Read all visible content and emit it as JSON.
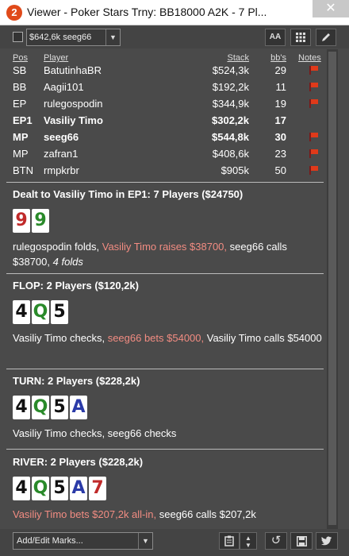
{
  "window": {
    "app_icon_text": "2",
    "title": "Viewer - Poker Stars Trny: BB18000 A2K - 7 Pl...",
    "close_glyph": "✕"
  },
  "toolbar": {
    "select_value": "$642,6k seeg66",
    "font_button_label": "AA"
  },
  "players": {
    "headers": {
      "pos": "Pos",
      "player": "Player",
      "stack": "Stack",
      "bbs": "bb's",
      "notes": "Notes"
    },
    "rows": [
      {
        "pos": "SB",
        "player": "BatutinhaBR",
        "stack": "$524,3k",
        "bbs": "29",
        "note": true,
        "bold": false
      },
      {
        "pos": "BB",
        "player": "Aagii101",
        "stack": "$192,2k",
        "bbs": "11",
        "note": true,
        "bold": false
      },
      {
        "pos": "EP",
        "player": "rulegospodin",
        "stack": "$344,9k",
        "bbs": "19",
        "note": true,
        "bold": false
      },
      {
        "pos": "EP1",
        "player": "Vasiliy Timo",
        "stack": "$302,2k",
        "bbs": "17",
        "note": false,
        "bold": true
      },
      {
        "pos": "MP",
        "player": "seeg66",
        "stack": "$544,8k",
        "bbs": "30",
        "note": true,
        "bold": true
      },
      {
        "pos": "MP",
        "player": "zafran1",
        "stack": "$408,6k",
        "bbs": "23",
        "note": true,
        "bold": false
      },
      {
        "pos": "BTN",
        "player": "rmpkrbr",
        "stack": "$905k",
        "bbs": "50",
        "note": true,
        "bold": false
      }
    ]
  },
  "preflop": {
    "title": "Dealt to Vasiliy Timo in EP1: 7 Players ($24750)",
    "cards": [
      "9",
      "9"
    ],
    "action_1": "rulegospodin folds, ",
    "action_hl": "Vasiliy Timo raises $38700,",
    "action_2": " seeg66 calls $38700, ",
    "action_it": "4 folds"
  },
  "flop": {
    "title": "FLOP: 2 Players ($120,2k)",
    "cards": [
      "4",
      "Q",
      "5"
    ],
    "action_1": "Vasiliy Timo checks, ",
    "action_hl": "seeg66 bets $54000,",
    "action_2": " Vasiliy Timo calls $54000"
  },
  "turn": {
    "title": "TURN: 2 Players ($228,2k)",
    "cards": [
      "4",
      "Q",
      "5",
      "A"
    ],
    "action": "Vasiliy Timo checks, seeg66 checks"
  },
  "river": {
    "title": "RIVER: 2 Players ($228,2k)",
    "cards": [
      "4",
      "Q",
      "5",
      "A",
      "7"
    ],
    "action_hl": "Vasiliy Timo bets $207,2k all-in,",
    "action_2": " seeg66 calls $207,2k"
  },
  "bottombar": {
    "marks_label": "Add/Edit Marks..."
  },
  "colors": {
    "background": "#4a4a4a",
    "highlight": "#f28c82",
    "card_red": "#c02a2a",
    "card_green": "#2a8a2a",
    "card_black": "#111111",
    "card_blue": "#2a3aa8",
    "flag": "#e03a1a"
  }
}
